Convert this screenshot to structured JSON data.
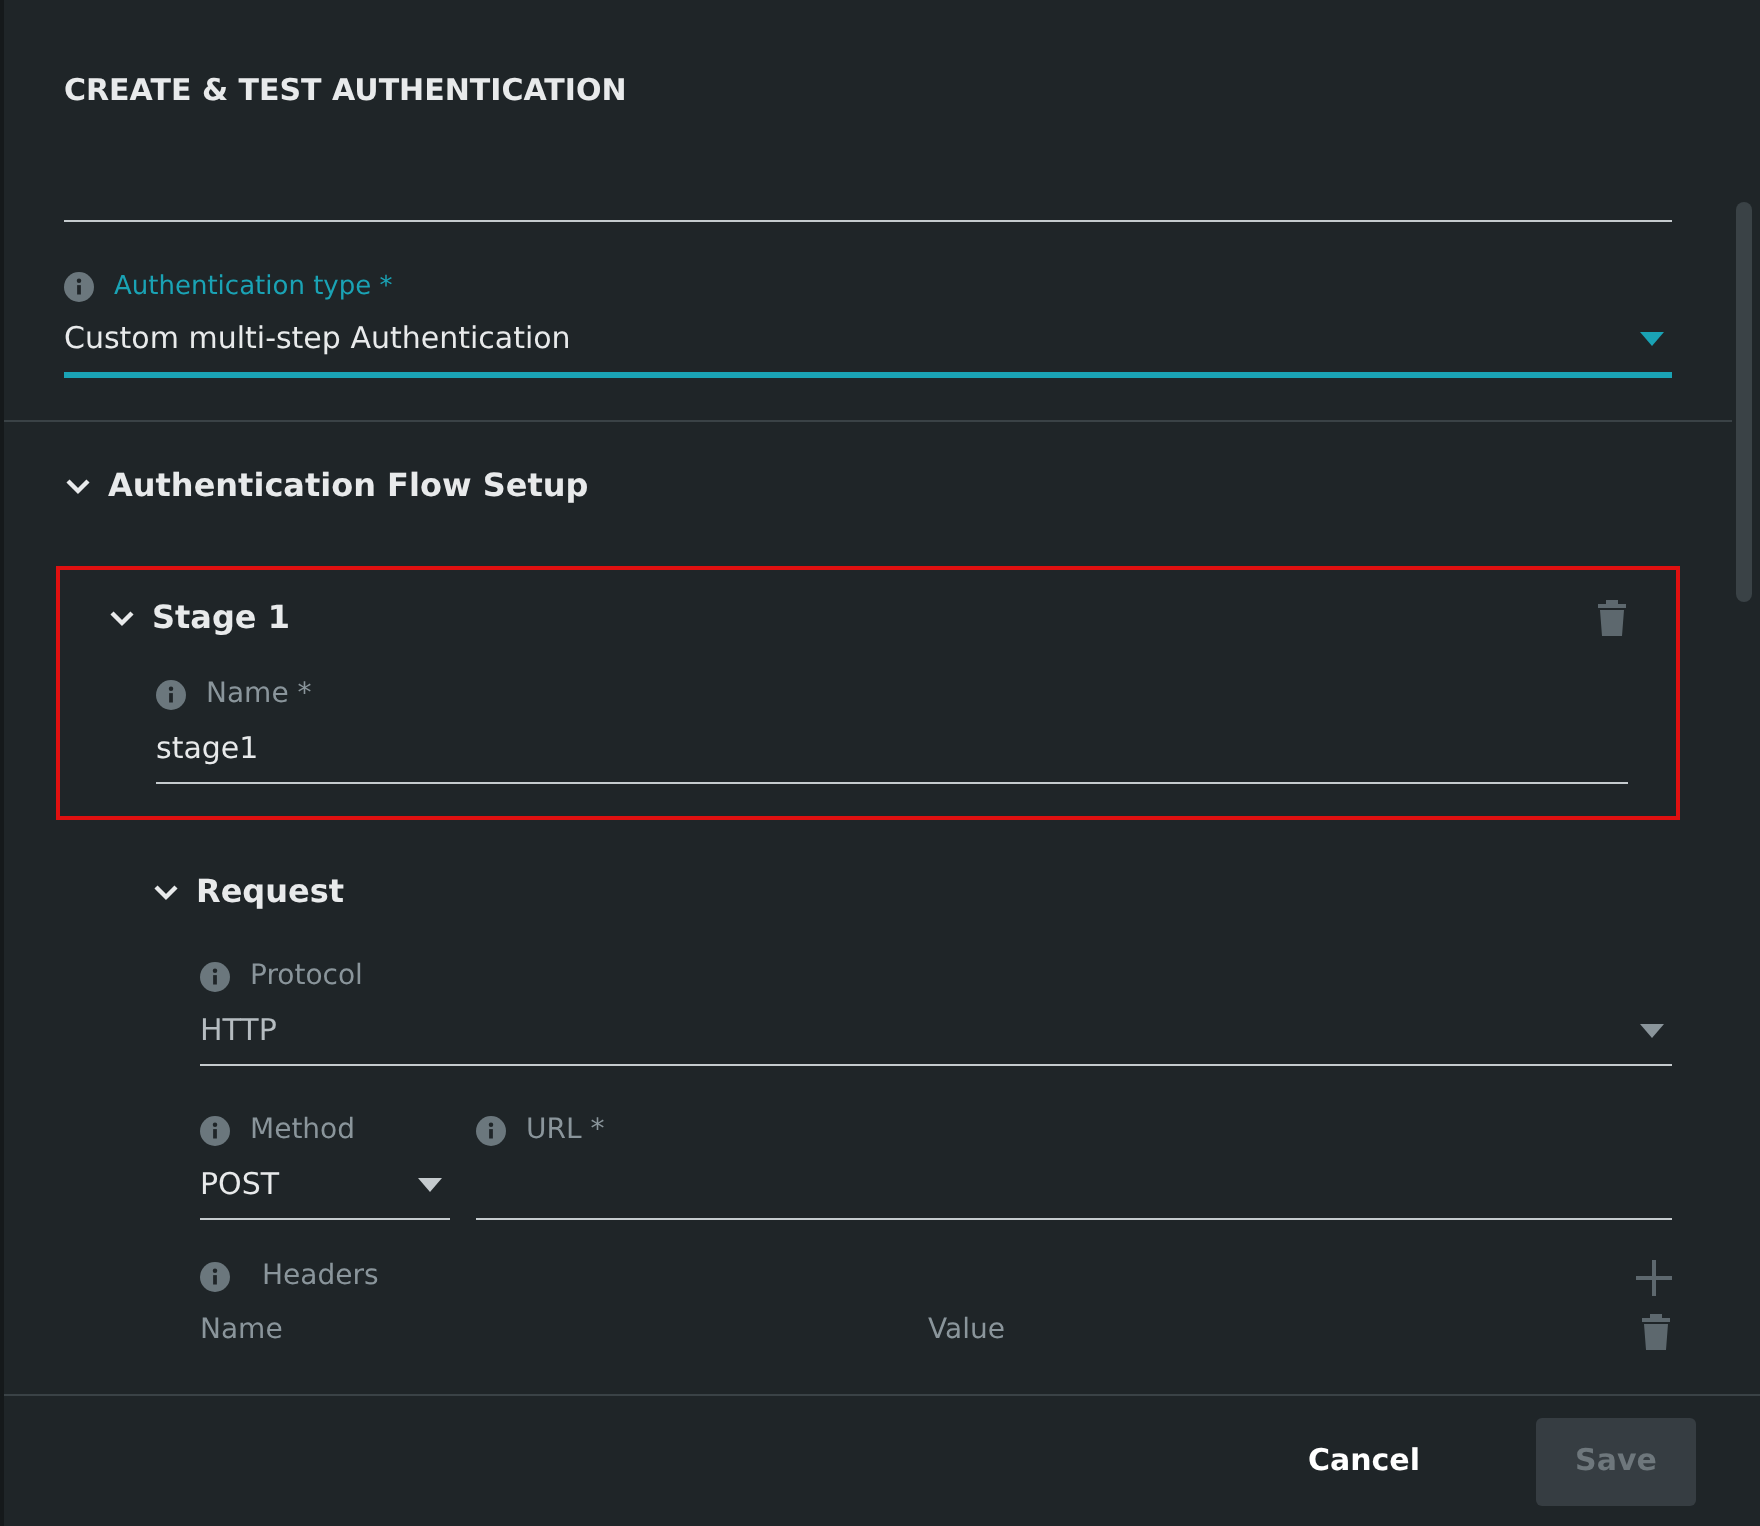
{
  "dialog": {
    "title": "CREATE & TEST AUTHENTICATION"
  },
  "auth_type": {
    "label": "Authentication type *",
    "value": "Custom multi-step Authentication",
    "focused": true
  },
  "section": {
    "title": "Authentication Flow Setup",
    "expanded": true
  },
  "stage": {
    "title": "Stage 1",
    "expanded": true,
    "highlighted": true,
    "name_field": {
      "label": "Name *",
      "value": "stage1"
    }
  },
  "request": {
    "title": "Request",
    "expanded": true,
    "protocol": {
      "label": "Protocol",
      "value": "HTTP",
      "disabled": true
    },
    "method": {
      "label": "Method",
      "value": "POST"
    },
    "url": {
      "label": "URL *"
    },
    "headers": {
      "label": "Headers",
      "columns": [
        "Name",
        "Value"
      ]
    }
  },
  "buttons": [
    {
      "label": "Cancel",
      "kind": "text",
      "disabled": false
    },
    {
      "label": "Save",
      "kind": "filled",
      "disabled": true
    }
  ]
}
